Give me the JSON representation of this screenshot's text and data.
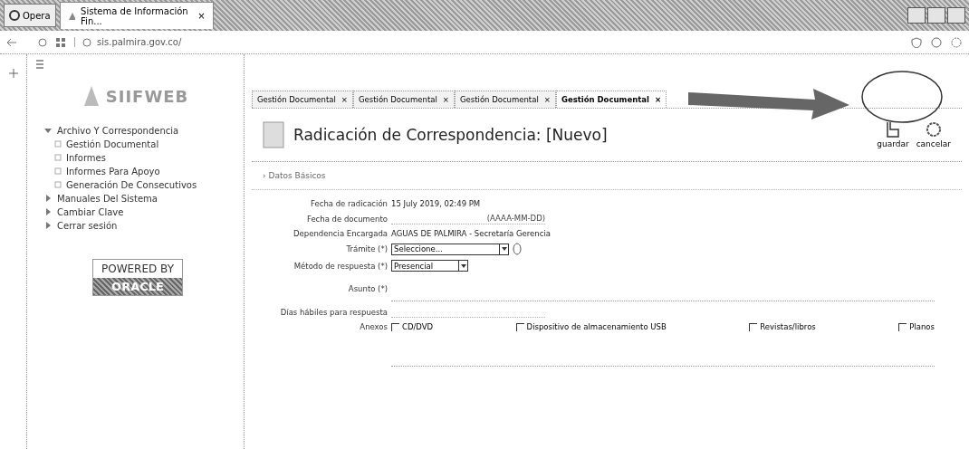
{
  "browser": {
    "menu_button": "Opera",
    "tabs": [
      {
        "label": "Sistema de Información Fin...",
        "selected": true,
        "close": "×"
      }
    ],
    "address": "sis.palmira.gov.co/"
  },
  "sidebar": {
    "logo": "SIIFWEB",
    "menu": [
      {
        "label": "Archivo Y Correspondencia",
        "expanded": true,
        "children": [
          {
            "label": "Gestión Documental"
          },
          {
            "label": "Informes"
          },
          {
            "label": "Informes Para Apoyo"
          },
          {
            "label": "Generación De Consecutivos"
          }
        ]
      },
      {
        "label": "Manuales Del Sistema",
        "expanded": false
      },
      {
        "label": "Cambiar Clave",
        "expanded": false
      },
      {
        "label": "Cerrar sesión",
        "expanded": false
      }
    ],
    "powered_by": "POWERED BY",
    "brand": "ORACLE"
  },
  "content_tabs": [
    {
      "label": "Gestión Documental",
      "close": "×",
      "selected": false
    },
    {
      "label": "Gestión Documental",
      "close": "×",
      "selected": false
    },
    {
      "label": "Gestión Documental",
      "close": "×",
      "selected": false
    },
    {
      "label": "Gestión Documental",
      "close": "×",
      "selected": true
    }
  ],
  "form": {
    "title": "Radicación de Correspondencia: [Nuevo]",
    "actions": [
      {
        "kind": "save",
        "label": "guardar"
      },
      {
        "kind": "cancel",
        "label": "cancelar"
      }
    ],
    "section_marker": "›",
    "section": "Datos Básicos",
    "fields": [
      {
        "kind": "text",
        "label": "Fecha de radicación",
        "value": "15 July 2019, 02:49 PM"
      },
      {
        "kind": "input",
        "label": "Fecha de documento",
        "placeholder": "(AAAA-MM-DD)"
      },
      {
        "kind": "text",
        "label": "Dependencia Encargada",
        "value": "AGUAS DE PALMIRA - Secretaría Gerencia"
      },
      {
        "kind": "select",
        "label": "Trámite (*)",
        "value": "Seleccione...",
        "help": true
      },
      {
        "kind": "select",
        "label": "Método de respuesta (*)",
        "value": "Presencial"
      },
      {
        "kind": "textarea",
        "label": "Asunto (*)"
      },
      {
        "kind": "input",
        "label": "Días hábiles para respuesta"
      },
      {
        "kind": "checks",
        "label": "Anexos",
        "options": [
          {
            "label": "CD/DVD",
            "checked": false
          },
          {
            "label": "Dispositivo de almacenamiento USB",
            "checked": false
          },
          {
            "label": "Revistas/libros",
            "checked": false
          },
          {
            "label": "Planos",
            "checked": false
          }
        ]
      },
      {
        "kind": "textarea"
      }
    ]
  }
}
